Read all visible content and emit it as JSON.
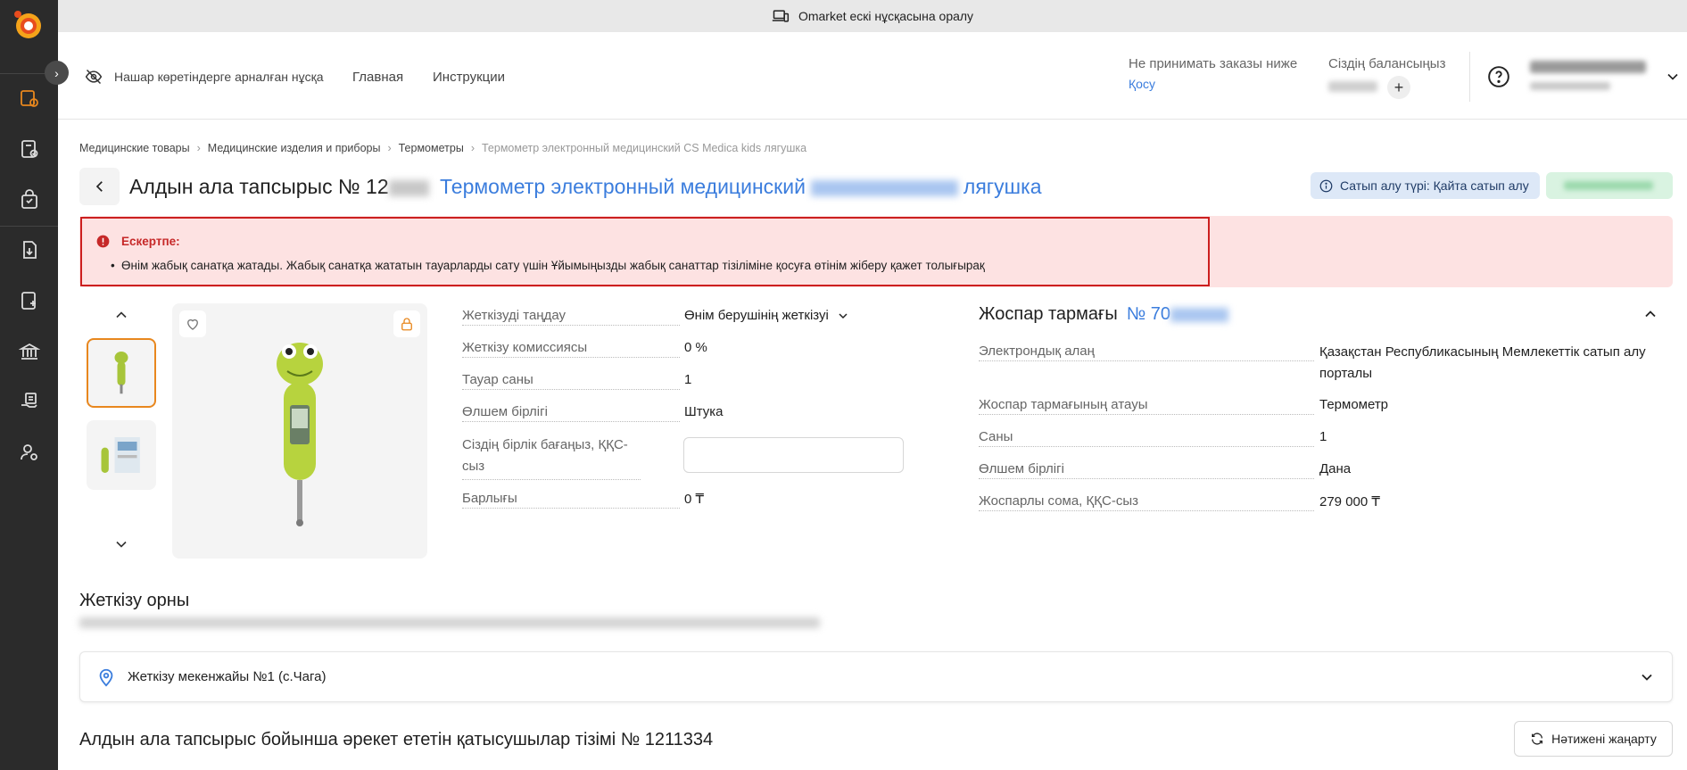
{
  "banner": {
    "text": "Omarket ескі нұсқасына оралу"
  },
  "header": {
    "low_vision": "Нашар көретіндерге арналған нұсқа",
    "nav": [
      "Главная",
      "Инструкции"
    ],
    "min_orders_label": "Не принимать заказы ниже",
    "min_orders_link": "Қосу",
    "balance_label": "Сіздің балансыңыз"
  },
  "breadcrumbs": [
    "Медицинские товары",
    "Медицинские изделия и приборы",
    "Термометры",
    "Термометр электронный медицинский CS Medica kids лягушка"
  ],
  "title": {
    "prefix": "Алдын ала тапсырыс № 12",
    "product_start": "Термометр электронный медицинский",
    "product_end": "лягушка"
  },
  "purchase_type": "Сатып алу түрі: Қайта сатып алу",
  "warning": {
    "title": "Ескертпе:",
    "text": "Өнім жабық санатқа жатады. Жабық санатқа жататын тауарларды сату үшін Ұйымыңызды жабық санаттар тізіліміне қосуға өтінім жіберу қажет толығырақ"
  },
  "delivery": {
    "choose_label": "Жеткізуді таңдау",
    "choose_value": "Өнім берушінің жеткізуі",
    "commission_label": "Жеткізу комиссиясы",
    "commission_value": "0 %",
    "quantity_label": "Тауар саны",
    "quantity_value": "1",
    "unit_label": "Өлшем бірлігі",
    "unit_value": "Штука",
    "price_label": "Сіздің бірлік бағаңыз, ҚҚС-сыз",
    "price_value": "",
    "total_label": "Барлығы",
    "total_value": "0 ₸"
  },
  "plan": {
    "title": "Жоспар тармағы",
    "number_prefix": "№ 70",
    "platform_label": "Электрондық алаң",
    "platform_value": "Қазақстан Республикасының Мемлекеттік сатып алу порталы",
    "name_label": "Жоспар тармағының атауы",
    "name_value": "Термометр",
    "count_label": "Саны",
    "count_value": "1",
    "unit_label": "Өлшем бірлігі",
    "unit_value": "Дана",
    "sum_label": "Жоспарлы сома, ҚҚС-сыз",
    "sum_value": "279 000 ₸"
  },
  "delivery_place": {
    "title": "Жеткізу орны",
    "address": "Жеткізу мекенжайы №1 (с.Чага)"
  },
  "participants": {
    "title": "Алдын ала тапсырыс бойынша әрекет ететін қатысушылар тізімі № 1211334",
    "refresh": "Нәтижені жаңарту"
  },
  "colors": {
    "accent": "#3b7ddd",
    "brand": "#e8871e",
    "warning_bg": "#fde2e2",
    "warning_border": "#cc1f1f"
  }
}
